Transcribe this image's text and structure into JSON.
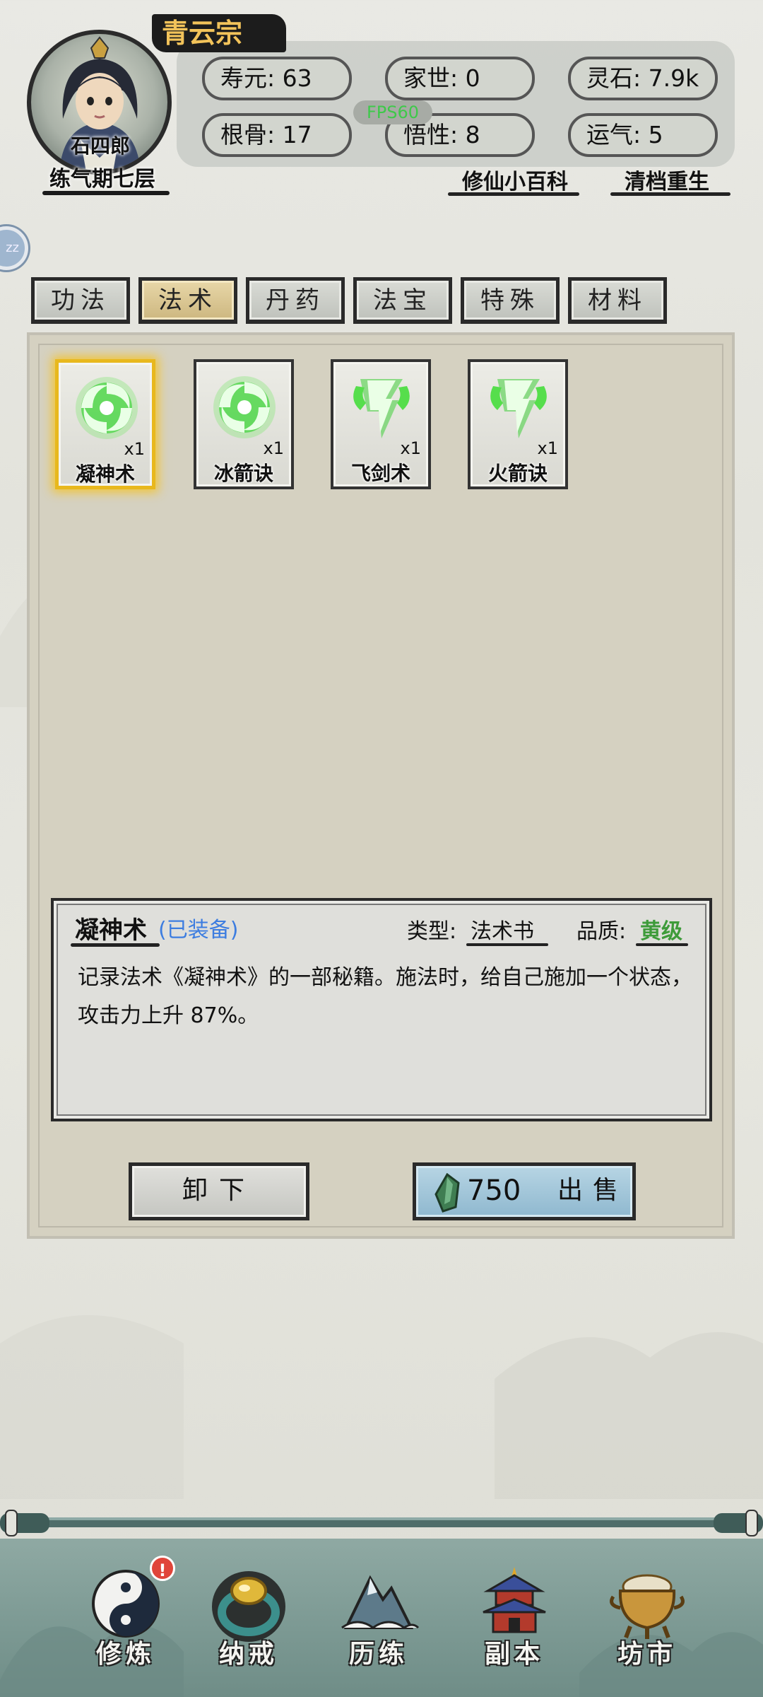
{
  "header": {
    "sect": "青云宗",
    "character_name": "石四郎",
    "realm": "练气期七层",
    "fps": "FPS60",
    "stats": [
      {
        "label": "寿元: 63"
      },
      {
        "label": "家世: 0"
      },
      {
        "label": "灵石: 7.9k"
      },
      {
        "label": "根骨: 17"
      },
      {
        "label": "悟性: 8"
      },
      {
        "label": "运气: 5"
      }
    ],
    "links": {
      "wiki": "修仙小百科",
      "reset": "清档重生"
    },
    "side_bubble": "zz"
  },
  "tabs": [
    {
      "label": "功法",
      "active": false
    },
    {
      "label": "法术",
      "active": true
    },
    {
      "label": "丹药",
      "active": false
    },
    {
      "label": "法宝",
      "active": false
    },
    {
      "label": "特殊",
      "active": false
    },
    {
      "label": "材料",
      "active": false
    }
  ],
  "items": [
    {
      "name": "凝神术",
      "count": "x1",
      "icon": "green-vortex-icon",
      "selected": true
    },
    {
      "name": "冰箭诀",
      "count": "x1",
      "icon": "green-vortex-icon",
      "selected": false
    },
    {
      "name": "飞剑术",
      "count": "x1",
      "icon": "green-bolt-icon",
      "selected": false
    },
    {
      "name": "火箭诀",
      "count": "x1",
      "icon": "green-bolt-icon",
      "selected": false
    }
  ],
  "detail": {
    "name": "凝神术",
    "status": "(已装备)",
    "type_label": "类型:",
    "type": "法术书",
    "quality_label": "品质:",
    "quality": "黄级",
    "description": "记录法术《凝神术》的一部秘籍。施法时，给自己施加一个状态，攻击力上升 87%。"
  },
  "actions": {
    "unequip": "卸下",
    "sell_price": "750",
    "sell": "出售"
  },
  "nav": [
    {
      "label": "修炼",
      "icon": "yin-yang-icon",
      "badge": "!"
    },
    {
      "label": "纳戒",
      "icon": "ring-icon"
    },
    {
      "label": "历练",
      "icon": "mountain-icon"
    },
    {
      "label": "副本",
      "icon": "pagoda-icon"
    },
    {
      "label": "坊市",
      "icon": "treasure-pot-icon"
    }
  ],
  "colors": {
    "accent_gold": "#e8b81d",
    "quality_green": "#3e9b3a",
    "equipped_blue": "#3d7de0",
    "fps_green": "#3ec94a"
  }
}
